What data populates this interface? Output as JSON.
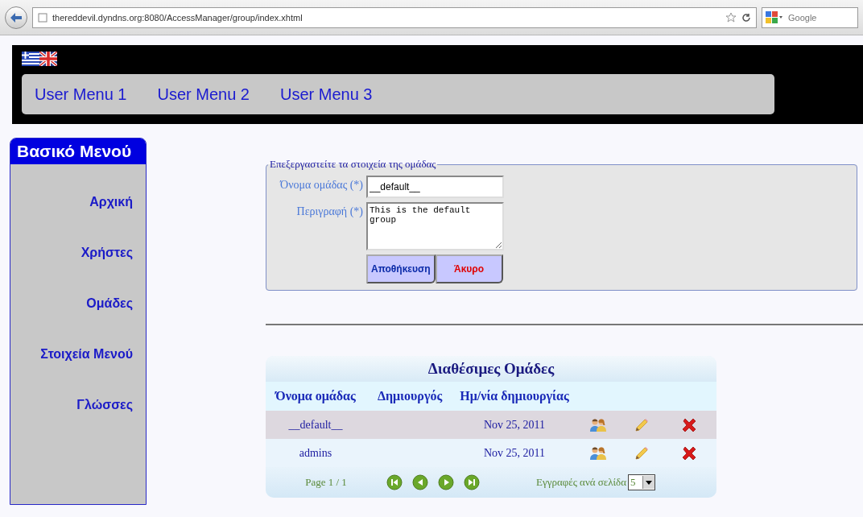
{
  "browser": {
    "url": "thereddevil.dyndns.org:8080/AccessManager/group/index.xhtml",
    "search_placeholder": "Google"
  },
  "top_menu": [
    "User Menu 1",
    "User Menu 2",
    "User Menu 3"
  ],
  "sidebar": {
    "title": "Βασικό Μενού",
    "items": [
      "Αρχική",
      "Χρήστες",
      "Ομάδες",
      "Στοιχεία Μενού",
      "Γλώσσες"
    ]
  },
  "form": {
    "legend": "Επεξεργαστείτε τα στοιχεία της ομάδας",
    "fields": [
      {
        "kind": "input",
        "label": "Όνομα ομάδας (*)",
        "value": "__default__"
      },
      {
        "kind": "textarea",
        "label": "Περιγραφή (*)",
        "value": "This is the default group"
      }
    ],
    "buttons": [
      {
        "kind": "save",
        "label": "Αποθήκευση"
      },
      {
        "kind": "cancel",
        "label": "Άκυρο"
      }
    ]
  },
  "table": {
    "title": "Διαθέσιμες Ομάδες",
    "columns": [
      "Όνομα ομάδας",
      "Δημιουργός",
      "Ημ/νία δημιουργίας"
    ],
    "rows": [
      {
        "name": "__default__",
        "date": "Nov 25, 2011",
        "selected": true
      },
      {
        "name": "admins",
        "date": "Nov 25, 2011",
        "selected": false
      }
    ],
    "footer": {
      "page": "Page 1 / 1",
      "per_page_label": "Εγγραφές ανά σελίδα",
      "per_page": "5"
    }
  }
}
